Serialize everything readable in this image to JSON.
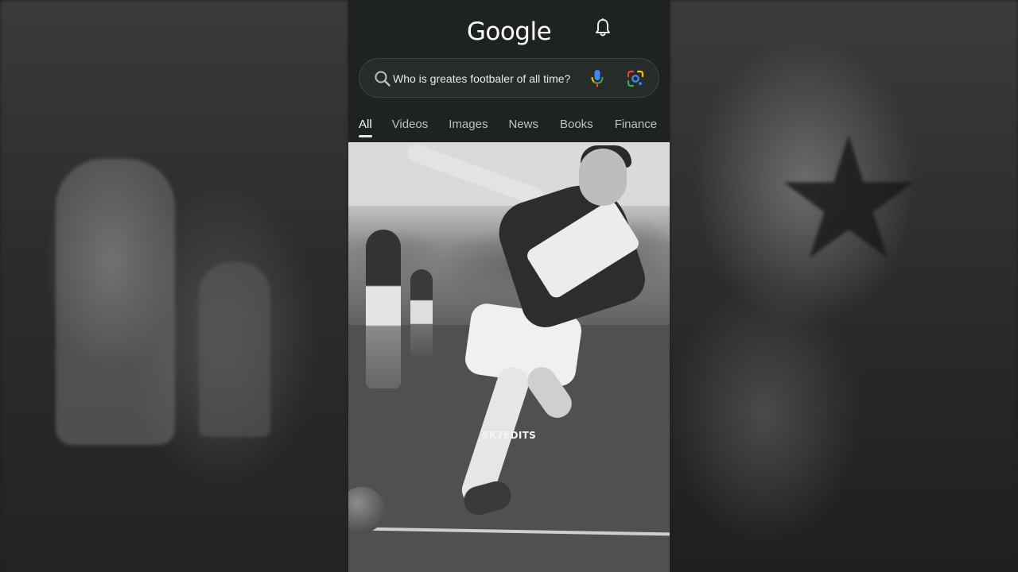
{
  "app": {
    "logo_text": "Google"
  },
  "search": {
    "query": "Who is greates footbaler of all time?"
  },
  "tabs": [
    {
      "label": "All",
      "active": true
    },
    {
      "label": "Videos",
      "active": false
    },
    {
      "label": "Images",
      "active": false
    },
    {
      "label": "News",
      "active": false
    },
    {
      "label": "Books",
      "active": false
    },
    {
      "label": "Finance",
      "active": false
    }
  ],
  "image": {
    "watermark": "SK7EDITS",
    "description_icons": [
      "bell-icon",
      "search-icon",
      "mic-icon",
      "lens-icon"
    ]
  },
  "colors": {
    "page_background": "#1f2320",
    "search_border": "#3f4543",
    "active_tab": "#ffffff",
    "inactive_tab": "#bdc1c6",
    "mic_blue": "#4285f4",
    "mic_red": "#ea4335"
  }
}
